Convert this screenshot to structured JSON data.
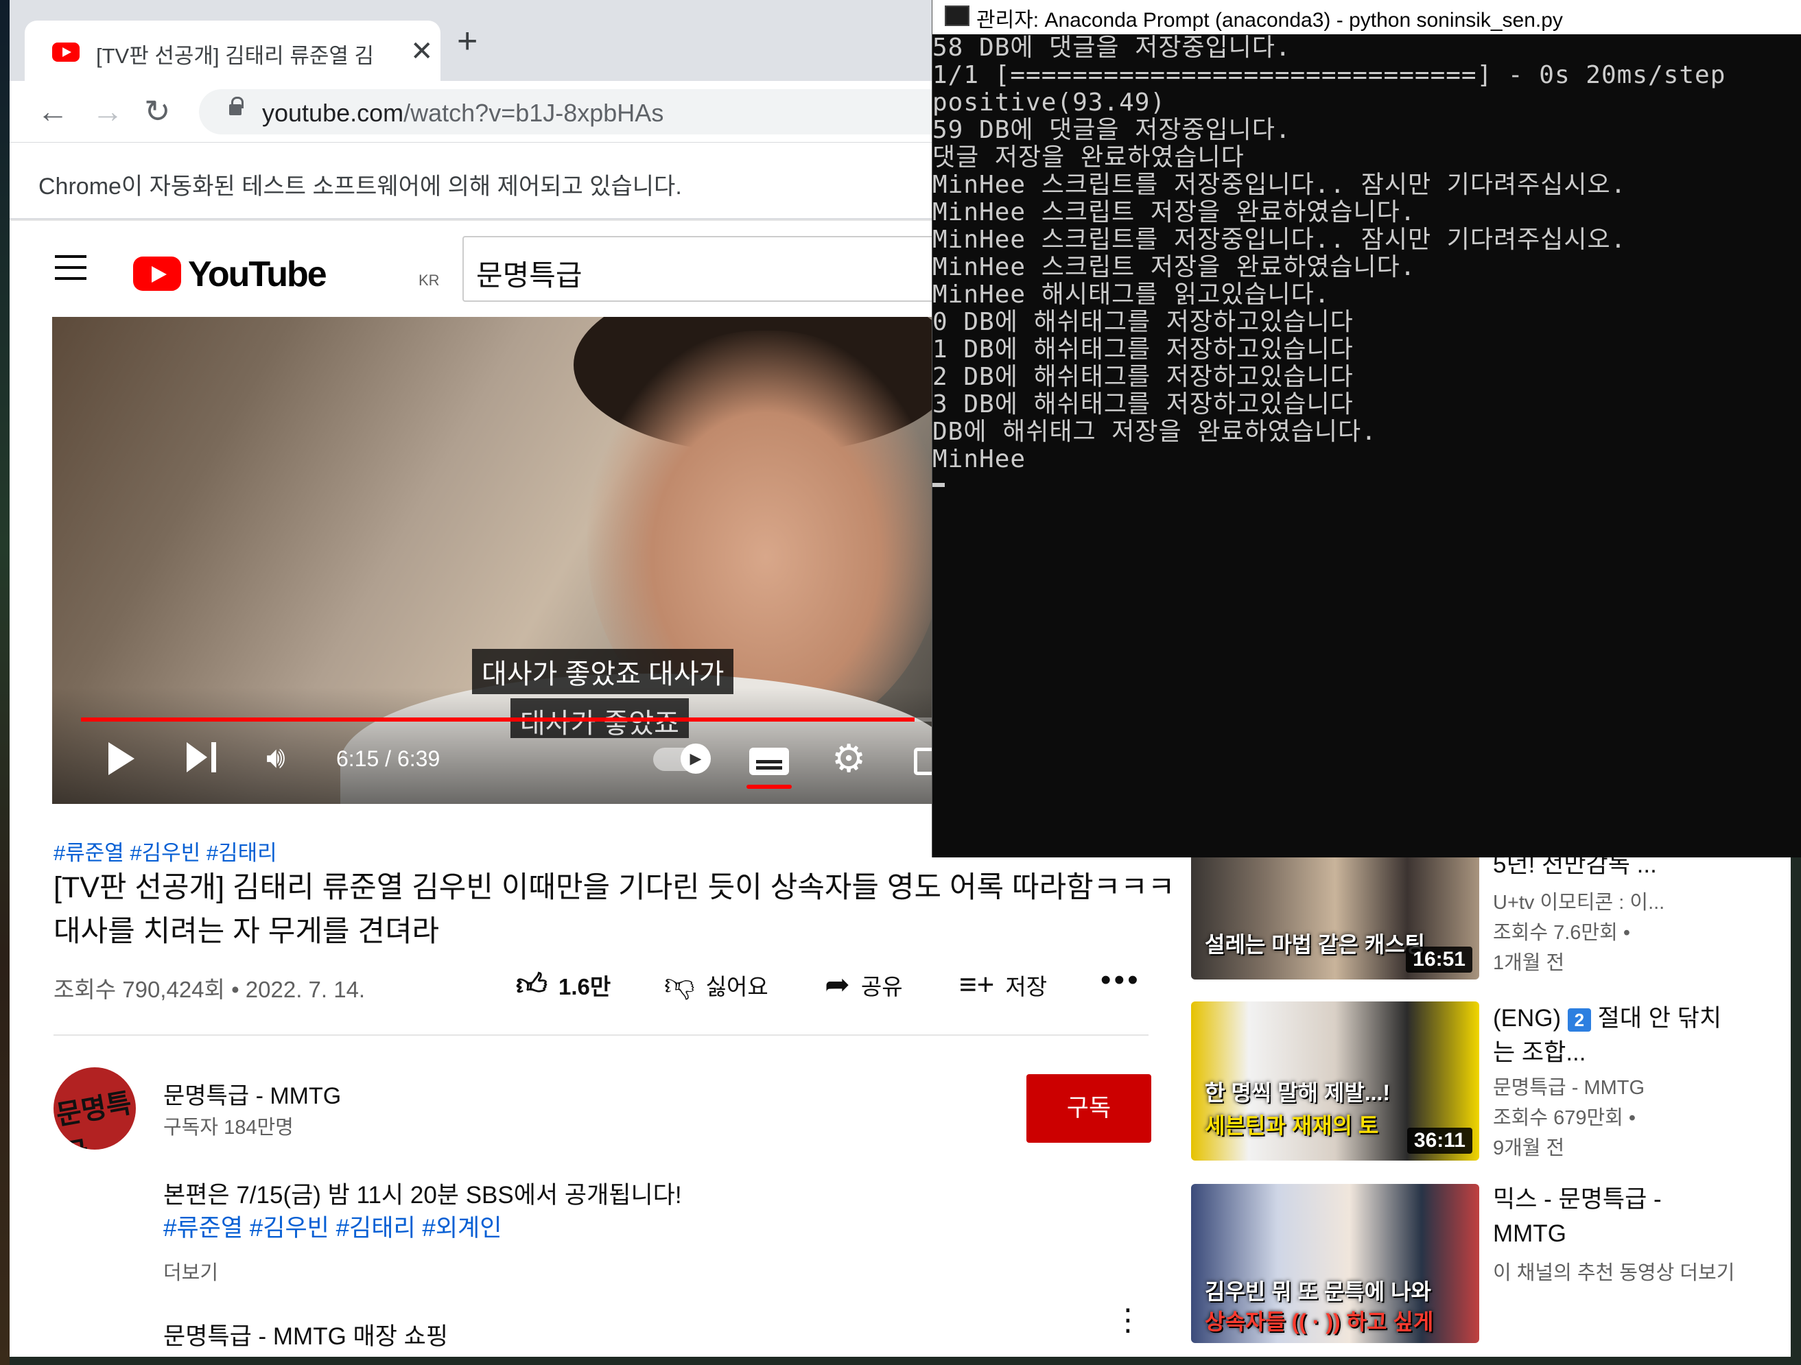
{
  "browser": {
    "tab_title": "[TV판 선공개] 김태리 류준열 김",
    "url_domain": "youtube.com",
    "url_path": "/watch?v=b1J-8xpbHAs",
    "automation_notice": "Chrome이 자동화된 테스트 소프트웨어에 의해 제어되고 있습니다."
  },
  "youtube": {
    "logo_text": "YouTube",
    "country_code": "KR",
    "search_value": "문명특급"
  },
  "player": {
    "caption_top": "대사가 좋았죠 대사가",
    "caption_bottom": "대사가 좋았죠",
    "time": "6:15 / 6:39",
    "progress": 0.942
  },
  "video": {
    "hashtags": "#류준열 #김우빈 #김태리",
    "title": "[TV판 선공개] 김태리 류준열 김우빈 이때만을 기다린 듯이 상속자들 영도 어록 따라함ㅋㅋㅋ 대사를 치려는 자 무게를 견뎌라",
    "views_date": "조회수 790,424회 • 2022. 7. 14.",
    "like_count": "1.6만",
    "dislike_label": "싫어요",
    "share_label": "공유",
    "save_label": "저장"
  },
  "channel": {
    "name": "문명특급 - MMTG",
    "subscribers": "구독자 184만명",
    "subscribe_label": "구독",
    "avatar_text": "문명특급",
    "description": "본편은 7/15(금) 밤 11시 20분 SBS에서 공개됩니다!",
    "description_tags": "#류준열 #김우빈 #김태리 #외계인",
    "show_more": "더보기",
    "merch_label": "문명특급 - MMTG 매장 쇼핑"
  },
  "recommendations": [
    {
      "title": "5년! 천만감독 ...",
      "channel": "U+tv 이모티콘 : 이...",
      "views": "조회수 7.6만회 •",
      "age": "1개월 전",
      "duration": "16:51",
      "thumb_text": "설레는 마법 같은 캐스팅"
    },
    {
      "title_badge": "2",
      "title_prefix": "(ENG)",
      "title_rest": "절대 안 닦치는 조합...",
      "channel": "문명특급 - MMTG",
      "views": "조회수 679만회 •",
      "age": "9개월 전",
      "duration": "36:11",
      "thumb_text_1": "한 명씩 말해 제발...!",
      "thumb_text_2": "세븐틴과 재재의 토"
    },
    {
      "title": "믹스 - 문명특급 - MMTG",
      "meta": "이 채널의 추천 동영상 더보기",
      "thumb_text_1": "김우빈 뭐 또 문특에 나와",
      "thumb_text_2": "상속자들 (( · )) 하고 싶게"
    }
  ],
  "terminal": {
    "title": "관리자: Anaconda Prompt (anaconda3) - python  soninsik_sen.py",
    "lines": [
      "58 DB에 댓글을 저장중입니다.",
      "1/1 [==============================] - 0s 20ms/step",
      "positive(93.49)",
      "59 DB에 댓글을 저장중입니다.",
      "댓글 저장을 완료하였습니다",
      "MinHee 스크립트를 저장중입니다.. 잠시만 기다려주십시오.",
      "MinHee 스크립트 저장을 완료하였습니다.",
      "MinHee 스크립트를 저장중입니다.. 잠시만 기다려주십시오.",
      "MinHee 스크립트 저장을 완료하였습니다.",
      "MinHee 해시태그를 읽고있습니다.",
      "0 DB에 해쉬태그를 저장하고있습니다",
      "1 DB에 해쉬태그를 저장하고있습니다",
      "2 DB에 해쉬태그를 저장하고있습니다",
      "3 DB에 해쉬태그를 저장하고있습니다",
      "DB에 해쉬태그 저장을 완료하였습니다.",
      "MinHee"
    ]
  },
  "colors": {
    "youtube_red": "#ff0000",
    "subscribe_red": "#cc0000",
    "link_blue": "#065fd4",
    "terminal_bg": "#0c0c0c",
    "terminal_text": "#cccccc"
  }
}
